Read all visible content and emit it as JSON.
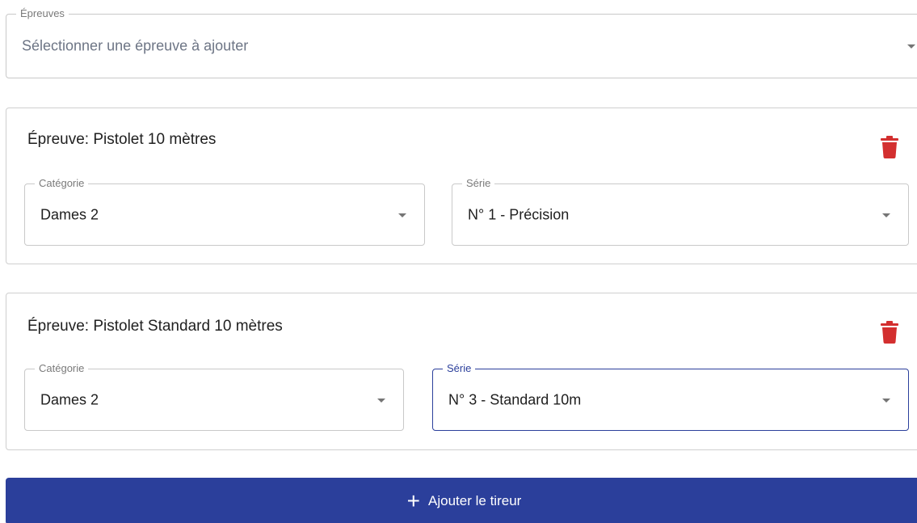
{
  "epreuves_select": {
    "label": "Épreuves",
    "placeholder": "Sélectionner une épreuve à ajouter"
  },
  "cards": [
    {
      "title": "Épreuve: Pistolet 10 mètres",
      "categorie": {
        "label": "Catégorie",
        "value": "Dames 2"
      },
      "serie": {
        "label": "Série",
        "value": "N° 1 - Précision",
        "focused": false
      }
    },
    {
      "title": "Épreuve: Pistolet Standard 10 mètres",
      "categorie": {
        "label": "Catégorie",
        "value": "Dames 2"
      },
      "serie": {
        "label": "Série",
        "value": "N° 3 - Standard 10m",
        "focused": true
      }
    }
  ],
  "submit": {
    "icon": "plus-icon",
    "label": "Ajouter le tireur"
  },
  "colors": {
    "primary": "#2b3f9b",
    "delete": "#d32f2f",
    "border": "#c9c9c9",
    "label": "#7a7a7a"
  }
}
